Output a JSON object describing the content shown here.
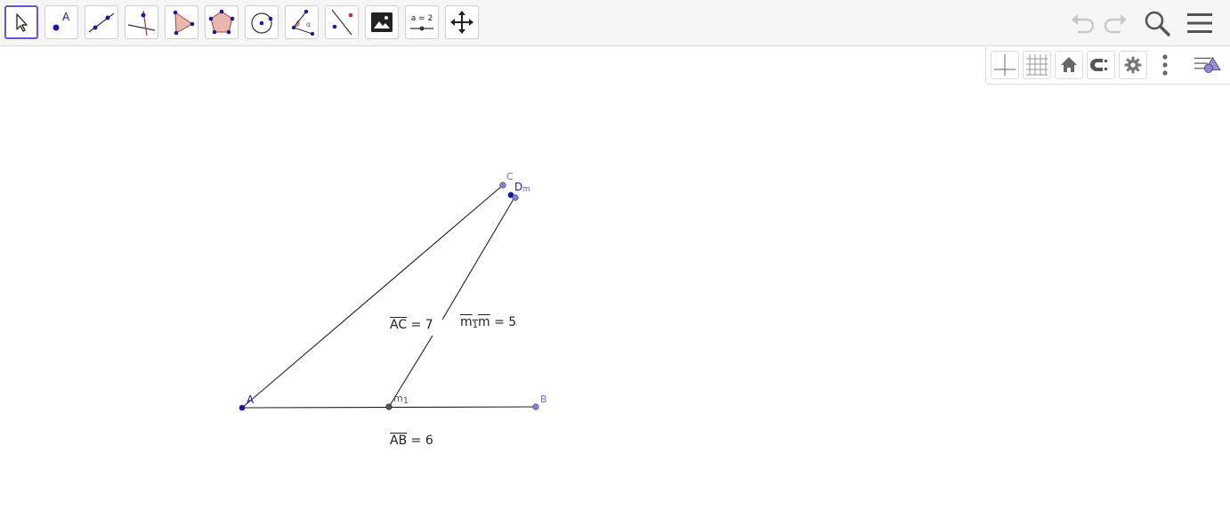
{
  "toolbar": {
    "tools": [
      {
        "name": "move-tool-icon",
        "active": true
      },
      {
        "name": "point-tool-icon",
        "label": "A"
      },
      {
        "name": "line-tool-icon"
      },
      {
        "name": "perpendicular-line-tool-icon"
      },
      {
        "name": "polygon-tool-icon"
      },
      {
        "name": "regular-polygon-tool-icon"
      },
      {
        "name": "circle-tool-icon"
      },
      {
        "name": "angle-tool-icon",
        "label": "α"
      },
      {
        "name": "reflect-tool-icon"
      },
      {
        "name": "image-tool-icon"
      },
      {
        "name": "slider-tool-icon",
        "label": "a = 2"
      },
      {
        "name": "move-graphics-view-tool-icon"
      }
    ],
    "right": [
      "undo-icon",
      "redo-icon",
      "search-icon",
      "hamburger-menu-icon"
    ]
  },
  "stylebar": {
    "buttons": [
      "axes-icon",
      "grid-icon",
      "home-icon",
      "point-capturing-icon",
      "settings-icon",
      "more-vertical-icon",
      "style-bar-toggle-icon"
    ]
  },
  "colors": {
    "active_tool_border": "#6557d2",
    "point_fill": "#1a1aa6",
    "point_light_fill": "#7f7fe6",
    "label_color": "#6c6cd6",
    "polygon_fill": "#e8b9ab"
  },
  "construction": {
    "points": {
      "A": "A",
      "B": "B",
      "C": "C",
      "D": "D",
      "m": "m",
      "m1": "m",
      "m1_sub": "1"
    },
    "measures": {
      "AC": {
        "segment": "AC",
        "value": "7"
      },
      "m1m": {
        "segment_a": "m",
        "segment_sub": "1",
        "segment_b": "m",
        "value": "5"
      },
      "AB": {
        "segment": "AB",
        "value": "6"
      }
    },
    "equals": "="
  }
}
